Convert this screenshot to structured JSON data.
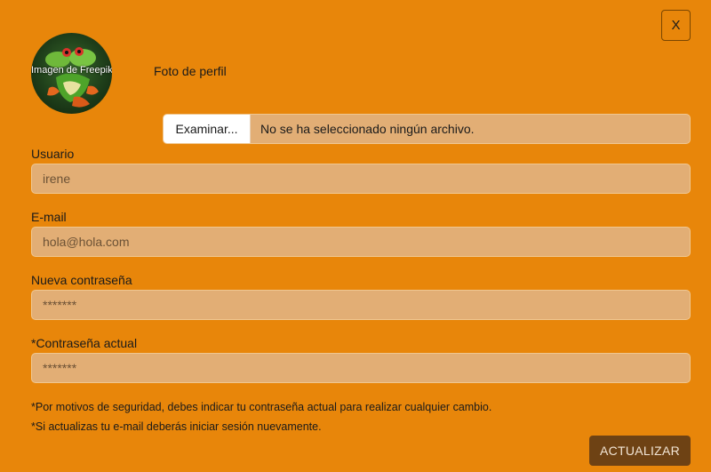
{
  "dialog": {
    "close_label": "X"
  },
  "profile": {
    "avatar_alt_text": "Imagen de Freepik",
    "photo_label": "Foto de perfil",
    "browse_button": "Examinar...",
    "file_status": "No se ha seleccionado ningún archivo."
  },
  "form": {
    "username": {
      "label": "Usuario",
      "placeholder": "irene"
    },
    "email": {
      "label": "E-mail",
      "placeholder": "hola@hola.com"
    },
    "new_password": {
      "label": "Nueva contraseña",
      "placeholder": "*******"
    },
    "current_password": {
      "label": "*Contraseña actual",
      "placeholder": "*******"
    }
  },
  "notes": {
    "security": "*Por motivos de seguridad, debes indicar tu contraseña actual para realizar cualquier cambio.",
    "email_change": "*Si actualizas tu e-mail deberás iniciar sesión nuevamente."
  },
  "actions": {
    "submit_label": "ACTUALIZAR"
  },
  "colors": {
    "background": "#E8860A",
    "input_fill": "#E2AE75",
    "button_dark": "#6E4214"
  }
}
